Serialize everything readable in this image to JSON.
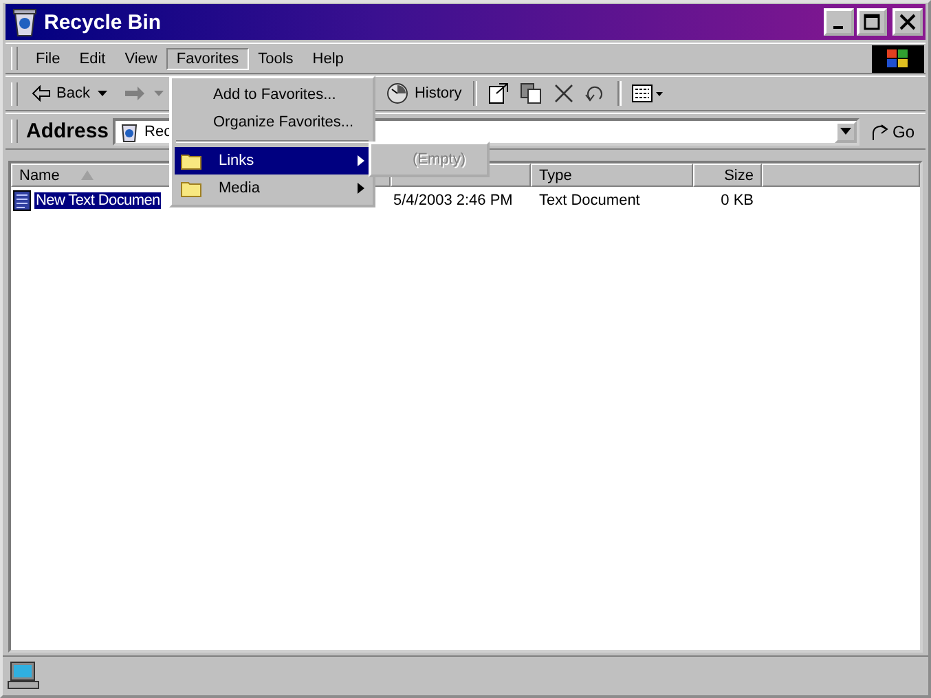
{
  "window": {
    "title": "Recycle Bin"
  },
  "menu_bar": [
    {
      "label": "File",
      "selected": false
    },
    {
      "label": "Edit",
      "selected": false
    },
    {
      "label": "View",
      "selected": false
    },
    {
      "label": "Favorites",
      "selected": true
    },
    {
      "label": "Tools",
      "selected": false
    },
    {
      "label": "Help",
      "selected": false
    }
  ],
  "toolbar": [
    {
      "kind": "back",
      "label": "Back",
      "disabled": false
    },
    {
      "kind": "forward",
      "disabled": true
    },
    {
      "kind": "history",
      "label": "History",
      "disabled": false
    },
    {
      "kind": "separator"
    },
    {
      "kind": "move"
    },
    {
      "kind": "copy"
    },
    {
      "kind": "delete"
    },
    {
      "kind": "undo"
    },
    {
      "kind": "separator"
    },
    {
      "kind": "views"
    }
  ],
  "address_bar": {
    "label": "Address",
    "value": "Rec",
    "go_label": "Go"
  },
  "table": {
    "columns": [
      {
        "label": "Name",
        "sorted": true
      },
      {},
      {
        "label": "Type"
      },
      {
        "label": "Size"
      }
    ],
    "rows": [
      {
        "name": "New Text Documen",
        "column_2": "5/4/2003 2:46 PM",
        "type": "Text Document",
        "size": "0 KB",
        "selected": true
      }
    ]
  },
  "favorites_menu": {
    "items": [
      {
        "label": "Add to Favorites...",
        "kind": "command",
        "selected": false
      },
      {
        "label": "Organize Favorites...",
        "kind": "command",
        "selected": false
      },
      {
        "kind": "separator"
      },
      {
        "label": "Links",
        "kind": "folder",
        "selected": true
      },
      {
        "label": "Media",
        "kind": "folder",
        "selected": false
      }
    ]
  },
  "links_submenu": {
    "items": [
      {
        "label": "(Empty)",
        "disabled": true
      }
    ]
  }
}
